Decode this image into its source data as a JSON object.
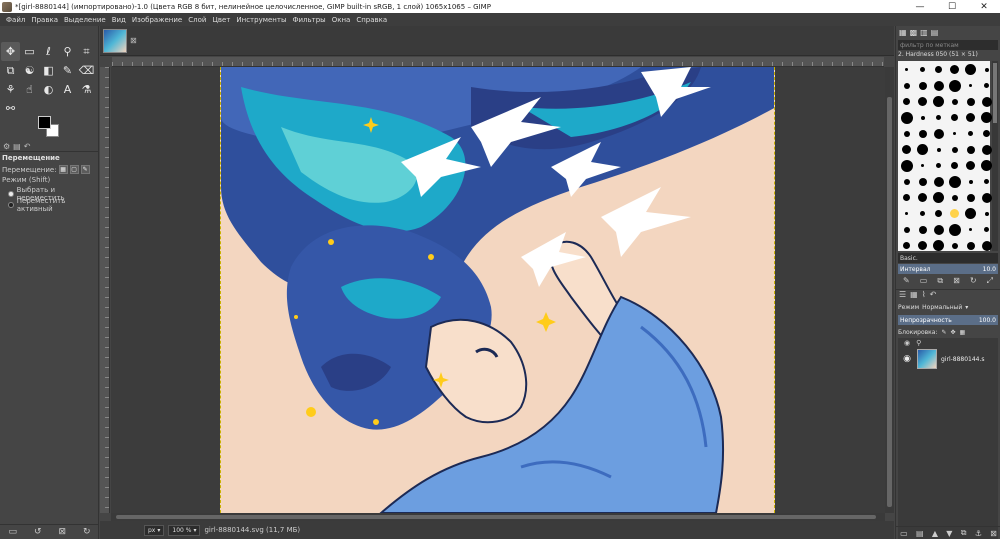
{
  "window": {
    "title": "*[girl-8880144] (импортировано)-1.0 (Цвета RGB 8 бит, нелинейное целочисленное, GIMP built-in sRGB, 1 слой) 1065x1065 – GIMP",
    "minimize": "—",
    "maximize": "☐",
    "close": "✕"
  },
  "menu": [
    "Файл",
    "Правка",
    "Выделение",
    "Вид",
    "Изображение",
    "Слой",
    "Цвет",
    "Инструменты",
    "Фильтры",
    "Окна",
    "Справка"
  ],
  "tools": [
    {
      "name": "move-tool-icon",
      "glyph": "✥",
      "active": true
    },
    {
      "name": "rect-select-icon",
      "glyph": "▭"
    },
    {
      "name": "lasso-icon",
      "glyph": "ℓ"
    },
    {
      "name": "fuzzy-select-icon",
      "glyph": "⚲"
    },
    {
      "name": "crop-icon",
      "glyph": "⌗"
    },
    {
      "name": "transform-icon",
      "glyph": "⧉"
    },
    {
      "name": "warp-icon",
      "glyph": "☯"
    },
    {
      "name": "bucket-fill-icon",
      "glyph": "◧"
    },
    {
      "name": "paintbrush-icon",
      "glyph": "✎"
    },
    {
      "name": "eraser-icon",
      "glyph": "⌫"
    },
    {
      "name": "clone-icon",
      "glyph": "⚘"
    },
    {
      "name": "smudge-icon",
      "glyph": "☝"
    },
    {
      "name": "dodge-icon",
      "glyph": "◐"
    },
    {
      "name": "text-tool-icon",
      "glyph": "A"
    },
    {
      "name": "color-picker-icon",
      "glyph": "⚗"
    },
    {
      "name": "zoom-icon",
      "glyph": "⚯"
    }
  ],
  "tool_options": {
    "title": "Перемещение",
    "move_label": "Перемещение:",
    "mode_label": "Режим (Shift)",
    "option1": "Выбрать и переместить",
    "option2": "Переместить активный"
  },
  "status": {
    "unit": "px",
    "zoom": "100 %",
    "file": "girl-8880144.svg (11,7 МБ)"
  },
  "brushes": {
    "filter_placeholder": "фильтр по меткам",
    "current": "2. Hardness 050 (51 × 51)",
    "preset": "Basic.",
    "spacing_label": "Интервал",
    "spacing_value": "10.0"
  },
  "layers": {
    "mode_label": "Режим",
    "mode_value": "Нормальный",
    "opacity_label": "Непрозрачность",
    "opacity_value": "100.0",
    "lock_label": "Блокировка:",
    "layer_name": "girl-8880144.s"
  },
  "colors": {
    "foreground": "#000000",
    "background": "#ffffff",
    "canvas_bg": "#f3d6c0"
  }
}
